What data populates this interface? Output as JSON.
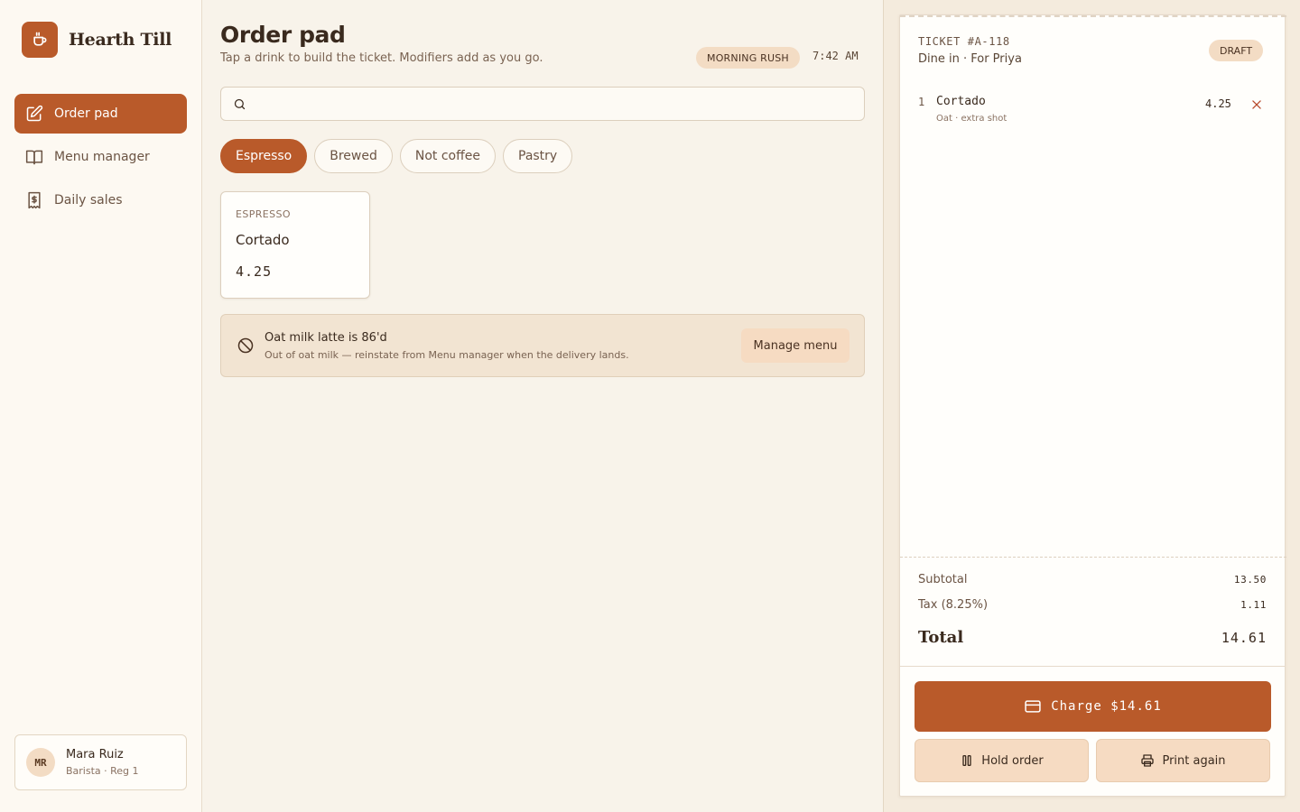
{
  "brand": {
    "name": "Hearth Till"
  },
  "sidebar": {
    "items": [
      {
        "label": "Order pad",
        "icon": "edit-icon",
        "active": true
      },
      {
        "label": "Menu manager",
        "icon": "book-icon",
        "active": false
      },
      {
        "label": "Daily sales",
        "icon": "receipt-dollar-icon",
        "active": false
      }
    ]
  },
  "user": {
    "initials": "MR",
    "name": "Mara Ruiz",
    "role": "Barista · Reg 1"
  },
  "header": {
    "title": "Order pad",
    "subtitle": "Tap a drink to build the ticket. Modifiers add as you go.",
    "shift": "MORNING RUSH",
    "time": "7:42 AM"
  },
  "search": {
    "value": "",
    "placeholder": ""
  },
  "tabs": [
    {
      "label": "Espresso",
      "active": true
    },
    {
      "label": "Brewed",
      "active": false
    },
    {
      "label": "Not coffee",
      "active": false
    },
    {
      "label": "Pastry",
      "active": false
    }
  ],
  "products": [
    {
      "category": "ESPRESSO",
      "name": "Cortado",
      "price": "4.25"
    }
  ],
  "alert": {
    "title": "Oat milk latte is 86'd",
    "body": "Out of oat milk — reinstate from Menu manager when the delivery lands.",
    "action": "Manage menu"
  },
  "ticket": {
    "id": "TICKET #A-118",
    "subtitle": "Dine in · For Priya",
    "status": "DRAFT",
    "items": [
      {
        "qty": "1",
        "name": "Cortado",
        "mods": "Oat · extra shot",
        "price": "4.25"
      }
    ],
    "subtotal_label": "Subtotal",
    "subtotal": "13.50",
    "tax_label": "Tax (8.25%)",
    "tax": "1.11",
    "total_label": "Total",
    "total": "14.61",
    "charge_label": "Charge $14.61",
    "hold_label": "Hold order",
    "print_label": "Print again"
  },
  "colors": {
    "accent": "#b95a2a",
    "background": "#f8f3ea",
    "badge": "#f3dcc4"
  }
}
